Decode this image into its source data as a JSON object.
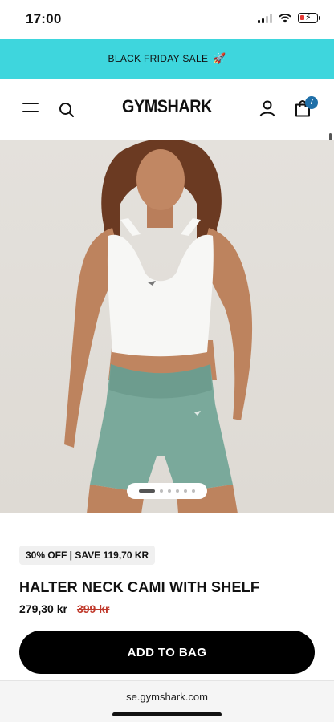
{
  "status_bar": {
    "time": "17:00"
  },
  "promo": {
    "text": "BLACK FRIDAY SALE",
    "icon": "rocket-icon"
  },
  "header": {
    "logo": "GYMSHARK",
    "bag_count": "7",
    "icons": [
      "menu-icon",
      "search-icon",
      "account-icon",
      "bag-icon"
    ]
  },
  "carousel": {
    "slide_count": 6,
    "active_slide": 1
  },
  "product": {
    "discount_badge": "30% OFF | SAVE 119,70 KR",
    "title": "HALTER NECK CAMI WITH SHELF",
    "price": "279,30 kr",
    "original_price": "399 kr",
    "add_to_bag_label": "ADD TO BAG"
  },
  "browser": {
    "url": "se.gymshark.com"
  },
  "colors": {
    "promo_bg": "#3ed6dd",
    "badge_bg": "#1f6fa8",
    "old_price": "#c0392b",
    "button_bg": "#000000"
  }
}
